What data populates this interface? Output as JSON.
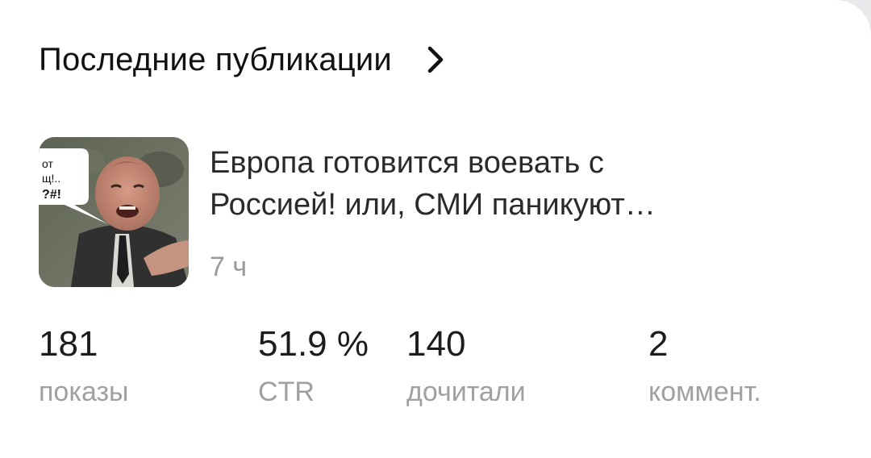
{
  "header": {
    "title": "Последние публикации",
    "chevron_icon": "chevron-right-icon"
  },
  "post": {
    "title_line1": "Европа готовится воевать с",
    "title_line2": "Россией! или, СМИ паникуют…",
    "time": "7 ч",
    "thumbnail": {
      "bubble_lines": [
        "от",
        "щ!..",
        "?#!"
      ]
    }
  },
  "stats": [
    {
      "value": "181",
      "label": "показы"
    },
    {
      "value": "51.9 %",
      "label": "CTR"
    },
    {
      "value": "140",
      "label": "дочитали"
    },
    {
      "value": "2",
      "label": "коммент."
    }
  ]
}
